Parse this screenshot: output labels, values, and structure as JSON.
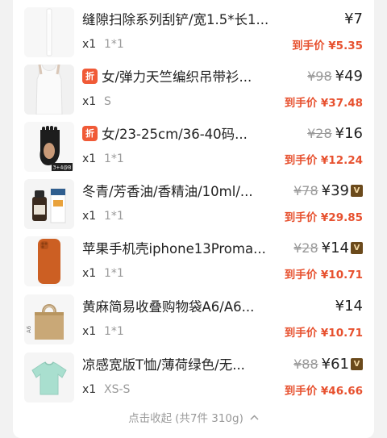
{
  "summary": {
    "collapse_label": "点击收起",
    "count_text": "(共7件 310g)"
  },
  "items": [
    {
      "title": "缝隙扫除系列刮铲/宽1.5*长1...",
      "discount_badge": "",
      "qty": "x1",
      "spec": "1*1",
      "orig_price": "",
      "price": "¥7",
      "vip_badge": "",
      "final_label": "到手价 ¥5.35",
      "image": "white-scraper-image"
    },
    {
      "title": "女/弹力天竺编织吊带衫...",
      "discount_badge": "折",
      "qty": "x1",
      "spec": "S",
      "orig_price": "¥98",
      "price": "¥49",
      "vip_badge": "",
      "final_label": "到手价 ¥37.48",
      "image": "white-camisole-image"
    },
    {
      "title": "女/23-25cm/36-40码...",
      "discount_badge": "折",
      "qty": "x1",
      "spec": "1*1",
      "orig_price": "¥28",
      "price": "¥16",
      "vip_badge": "",
      "final_label": "到手价 ¥12.24",
      "image": "black-toe-sock-image",
      "image_text": "3+4@B"
    },
    {
      "title": "冬青/芳香油/香精油/10ml/...",
      "discount_badge": "",
      "qty": "x1",
      "spec": "1*1",
      "orig_price": "¥78",
      "price": "¥39",
      "vip_badge": "V",
      "final_label": "到手价 ¥29.85",
      "image": "essential-oil-bottle-image"
    },
    {
      "title": "苹果手机壳iphone13Proma...",
      "discount_badge": "",
      "qty": "x1",
      "spec": "1*1",
      "orig_price": "¥28",
      "price": "¥14",
      "vip_badge": "V",
      "final_label": "到手价 ¥10.71",
      "image": "orange-phone-case-image"
    },
    {
      "title": "黄麻简易收叠购物袋A6/A6...",
      "discount_badge": "",
      "qty": "x1",
      "spec": "1*1",
      "orig_price": "",
      "price": "¥14",
      "vip_badge": "",
      "final_label": "到手价 ¥10.71",
      "image": "jute-bag-image",
      "image_text": "A6"
    },
    {
      "title": "凉感宽版T恤/薄荷绿色/无...",
      "discount_badge": "",
      "qty": "x1",
      "spec": "XS-S",
      "orig_price": "¥88",
      "price": "¥61",
      "vip_badge": "V",
      "final_label": "到手价 ¥46.66",
      "image": "mint-tshirt-image"
    }
  ],
  "colors": {
    "accent_red": "#e7512f",
    "discount_badge_bg": "#f05a37",
    "vip_badge_bg": "#6b4a1c",
    "muted_text": "#9a9a9a"
  }
}
